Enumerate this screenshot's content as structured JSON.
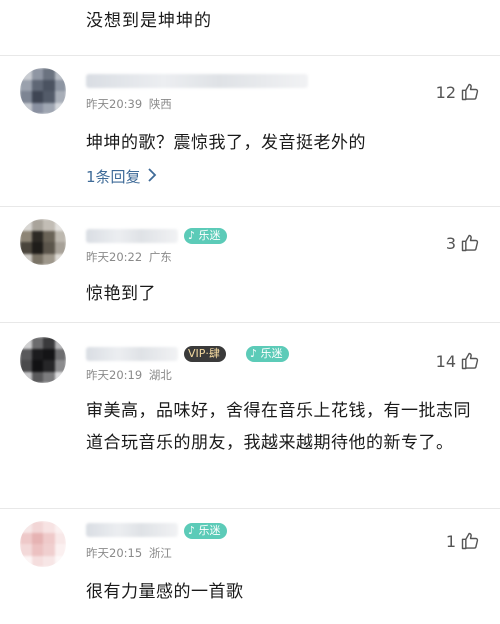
{
  "top_comment_tail": "没想到是坤坤的",
  "comments": [
    {
      "time": "昨天20:39",
      "location": "陕西",
      "likes": "12",
      "text": "坤坤的歌？震惊我了，发音挺老外的",
      "replies_label": "1条回复"
    },
    {
      "time": "昨天20:22",
      "location": "广东",
      "likes": "3",
      "badge_fan": "乐迷",
      "text": "惊艳到了"
    },
    {
      "time": "昨天20:19",
      "location": "湖北",
      "likes": "14",
      "badge_vip": "VIP·肆",
      "badge_fan": "乐迷",
      "text": "审美高，品味好，舍得在音乐上花钱，有一批志同道合玩音乐的朋友，我越来越期待他的新专了。"
    },
    {
      "time": "昨天20:15",
      "location": "浙江",
      "likes": "1",
      "badge_fan": "乐迷",
      "text": "很有力量感的一首歌"
    }
  ],
  "icons": {
    "like": "thumbs-up-icon",
    "chevron": "chevron-right-icon"
  },
  "colors": {
    "fan_badge": "#5ccbb8",
    "reply_link": "#3f6b98",
    "meta_text": "#8a8a8a"
  }
}
